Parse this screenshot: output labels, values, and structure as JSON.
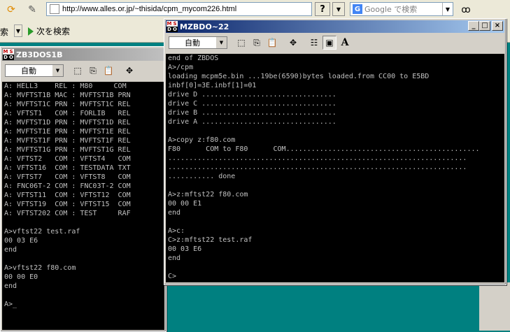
{
  "browser": {
    "address": "http://www.alles.or.jp/~thisida/cpm_mycom226.html",
    "help_btn": "?",
    "search_placeholder": "Google で検索",
    "left_fragment": "索",
    "next_search": "次を検索"
  },
  "back_window": {
    "title": "ZB3DOS1B",
    "font": "自動",
    "lines": [
      "A: HELL3    REL : M80     COM",
      "A: MVFTST1B MAC : MVFTST1B PRN",
      "A: MVFTST1C PRN : MVFTST1C REL",
      "A: VFTST1   COM : FORLIB   REL",
      "A: MVFTST1D PRN : MVFTST1D REL",
      "A: MVFTST1E PRN : MVFTST1E REL",
      "A: MVFTST1F PRN : MVFTST1F REL",
      "A: MVFTST1G PRN : MVFTST1G REL",
      "A: VFTST2   COM : VFTST4   COM",
      "A: VFTST16  COM : TESTDATA TXT",
      "A: VFTST7   COM : VFTST8   COM",
      "A: FNC06T-2 COM : FNC03T-2 COM",
      "A: VFTST11  COM : VFTST12  COM",
      "A: VFTST19  COM : VFTST15  COM",
      "A: VFTST202 COM : TEST     RAF",
      "",
      "A>vftst22 test.raf",
      "00 03 E6",
      "end",
      "",
      "A>vftst22 f80.com",
      "00 00 E0",
      "end",
      "",
      "A>_"
    ]
  },
  "front_window": {
    "title": "MZBDO~22",
    "font": "自動",
    "lines": [
      "end of ZBDOS",
      "A>/cpm",
      "loading mcpm5e.bin ...19be(6590)bytes loaded.from CC00 to E5BD",
      "inbf[0]=3E.inbf[1]=01",
      "drive D ................................",
      "drive C ................................",
      "drive B ................................",
      "drive A ................................",
      "",
      "A>copy z:f80.com",
      "F80      COM to F80      COM..............................................",
      ".......................................................................",
      ".......................................................................",
      "........... done",
      "",
      "A>z:mftst22 f80.com",
      "00 00 E1",
      "end",
      "",
      "A>c:",
      "C>z:mftst22 test.raf",
      "00 03 E6",
      "end",
      "",
      "C>"
    ]
  },
  "icons": {
    "minimize": "_",
    "maximize": "□",
    "close": "×"
  }
}
